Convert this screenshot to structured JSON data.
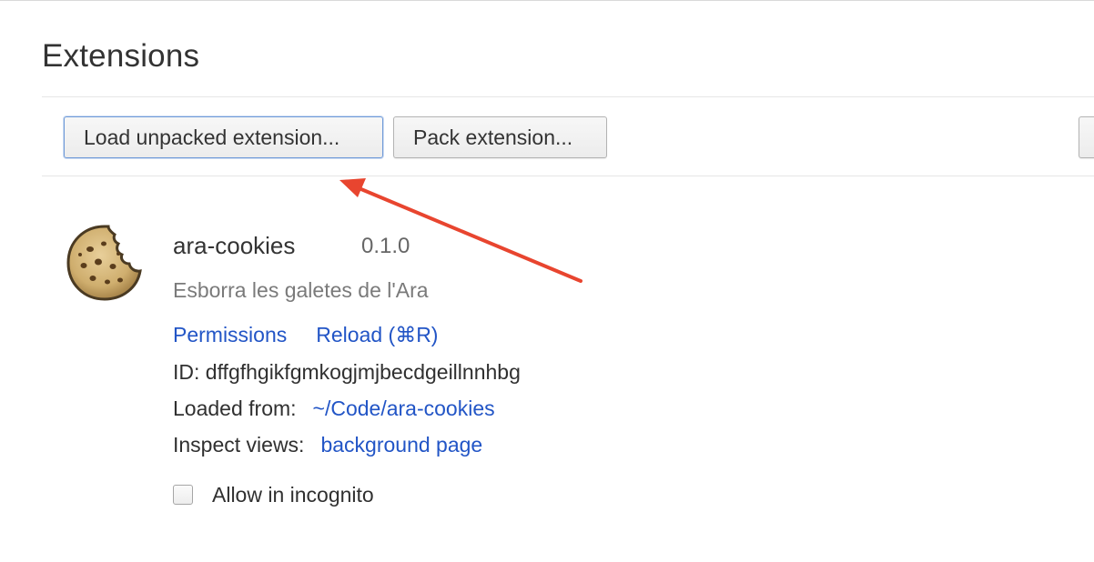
{
  "page": {
    "title": "Extensions"
  },
  "toolbar": {
    "load_unpacked_label": "Load unpacked extension...",
    "pack_label": "Pack extension...",
    "update_label": ""
  },
  "extension": {
    "icon": "cookie-icon",
    "name": "ara-cookies",
    "version": "0.1.0",
    "description": "Esborra les galetes de l'Ara",
    "permissions_link": "Permissions",
    "reload_link": "Reload (⌘R)",
    "id_label": "ID:",
    "id_value": "dffgfhgikfgmkogjmjbecdgeillnnhbg",
    "loaded_from_label": "Loaded from:",
    "loaded_from_value": "~/Code/ara-cookies",
    "inspect_views_label": "Inspect views:",
    "inspect_views_value": "background page",
    "incognito_label": "Allow in incognito",
    "incognito_checked": false
  },
  "annotation": {
    "arrow_color": "#e8452f",
    "points_to": "load-unpacked-button"
  },
  "colors": {
    "link": "#2255c6",
    "text": "#303030",
    "muted": "#7a7a7a",
    "button_focus_border": "#6f9ad8"
  }
}
